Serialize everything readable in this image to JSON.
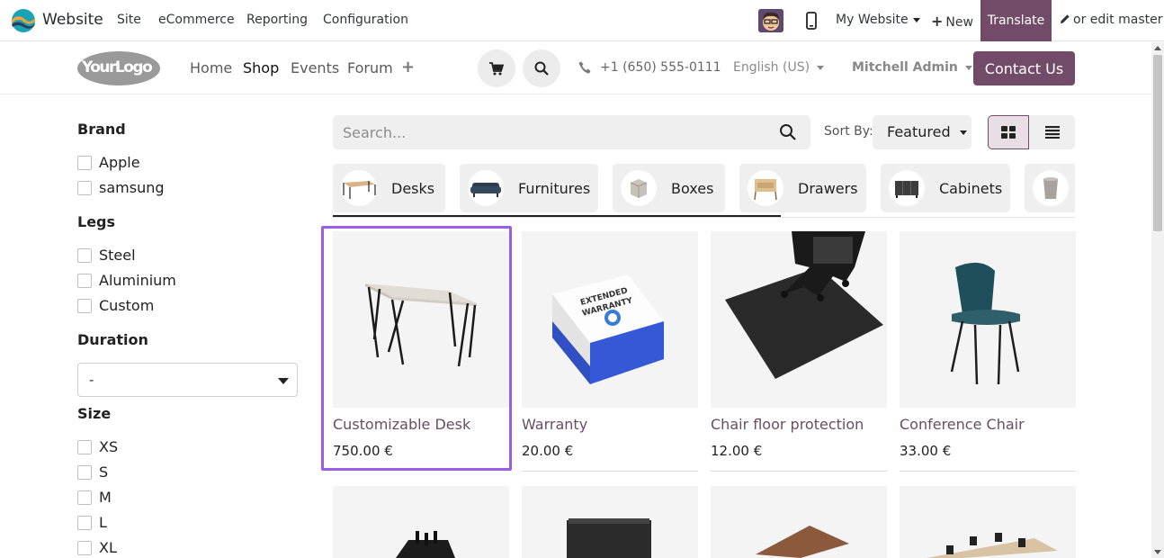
{
  "topbar": {
    "app_name": "Website",
    "menu": [
      "Site",
      "eCommerce",
      "Reporting",
      "Configuration"
    ],
    "my_website": "My Website",
    "new_label": "New",
    "translate_label": "Translate",
    "edit_label": "or edit master"
  },
  "header": {
    "logo_text": "YourLogo",
    "nav": [
      "Home",
      "Shop",
      "Events",
      "Forum"
    ],
    "active_nav": "Shop",
    "phone": "+1 (650) 555-0111",
    "language": "English (US)",
    "user": "Mitchell Admin",
    "contact_label": "Contact Us"
  },
  "sidebar": {
    "brand_title": "Brand",
    "brands": [
      "Apple",
      "samsung"
    ],
    "legs_title": "Legs",
    "legs": [
      "Steel",
      "Aluminium",
      "Custom"
    ],
    "duration_title": "Duration",
    "duration_value": "-",
    "size_title": "Size",
    "sizes": [
      "XS",
      "S",
      "M",
      "L",
      "XL"
    ]
  },
  "toolbar": {
    "search_placeholder": "Search...",
    "sort_label": "Sort By:",
    "sort_value": "Featured"
  },
  "categories": [
    "Desks",
    "Furnitures",
    "Boxes",
    "Drawers",
    "Cabinets"
  ],
  "products": [
    {
      "name": "Customizable Desk",
      "price": "750.00 €"
    },
    {
      "name": "Warranty",
      "price": "20.00 €"
    },
    {
      "name": "Chair floor protection",
      "price": "12.00 €"
    },
    {
      "name": "Conference Chair",
      "price": "33.00 €"
    }
  ],
  "colors": {
    "brand": "#714b67",
    "highlight": "#9b5de5",
    "product_name": "#6a4c64"
  }
}
